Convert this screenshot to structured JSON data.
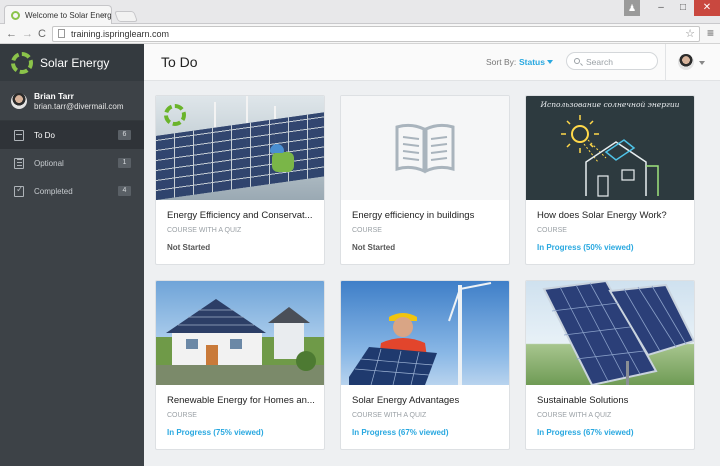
{
  "browser": {
    "tab_title": "Welcome to Solar Energy",
    "tab_close": "×",
    "url": "training.ispringlearn.com",
    "back": "←",
    "forward": "→",
    "reload": "C",
    "star": "☆",
    "menu": "≡",
    "minimize": "–",
    "maximize": "□",
    "close": "✕",
    "profile": "♟"
  },
  "sidebar": {
    "brand": "Solar Energy",
    "user_name": "Brian Tarr",
    "user_email": "brian.tarr@divermail.com",
    "items": [
      {
        "label": "To Do",
        "count": "6",
        "icon": "calendar-icon"
      },
      {
        "label": "Optional",
        "count": "1",
        "icon": "document-icon"
      },
      {
        "label": "Completed",
        "count": "4",
        "icon": "checkbox-icon"
      }
    ]
  },
  "header": {
    "title": "To Do",
    "sort_label": "Sort By:",
    "sort_value": "Status",
    "search_placeholder": "Search"
  },
  "cards": [
    {
      "title": "Energy Efficiency and Conservat...",
      "type": "Course with a quiz",
      "status": "Not Started"
    },
    {
      "title": "Energy efficiency in buildings",
      "type": "Course",
      "status": "Not Started"
    },
    {
      "title": "How does Solar Energy Work?",
      "type": "Course",
      "status": "In Progress (50% viewed)",
      "board_caption": "Использование солнечной энергии"
    },
    {
      "title": "Renewable Energy for Homes an...",
      "type": "Course",
      "status": "In Progress (75% viewed)"
    },
    {
      "title": "Solar Energy Advantages",
      "type": "Course with a quiz",
      "status": "In Progress (67% viewed)"
    },
    {
      "title": "Sustainable Solutions",
      "type": "Course with a quiz",
      "status": "In Progress (67% viewed)"
    }
  ],
  "colors": {
    "accent": "#29a8e0",
    "sidebar": "#3d4247",
    "brand_green": "#8bc34a"
  }
}
